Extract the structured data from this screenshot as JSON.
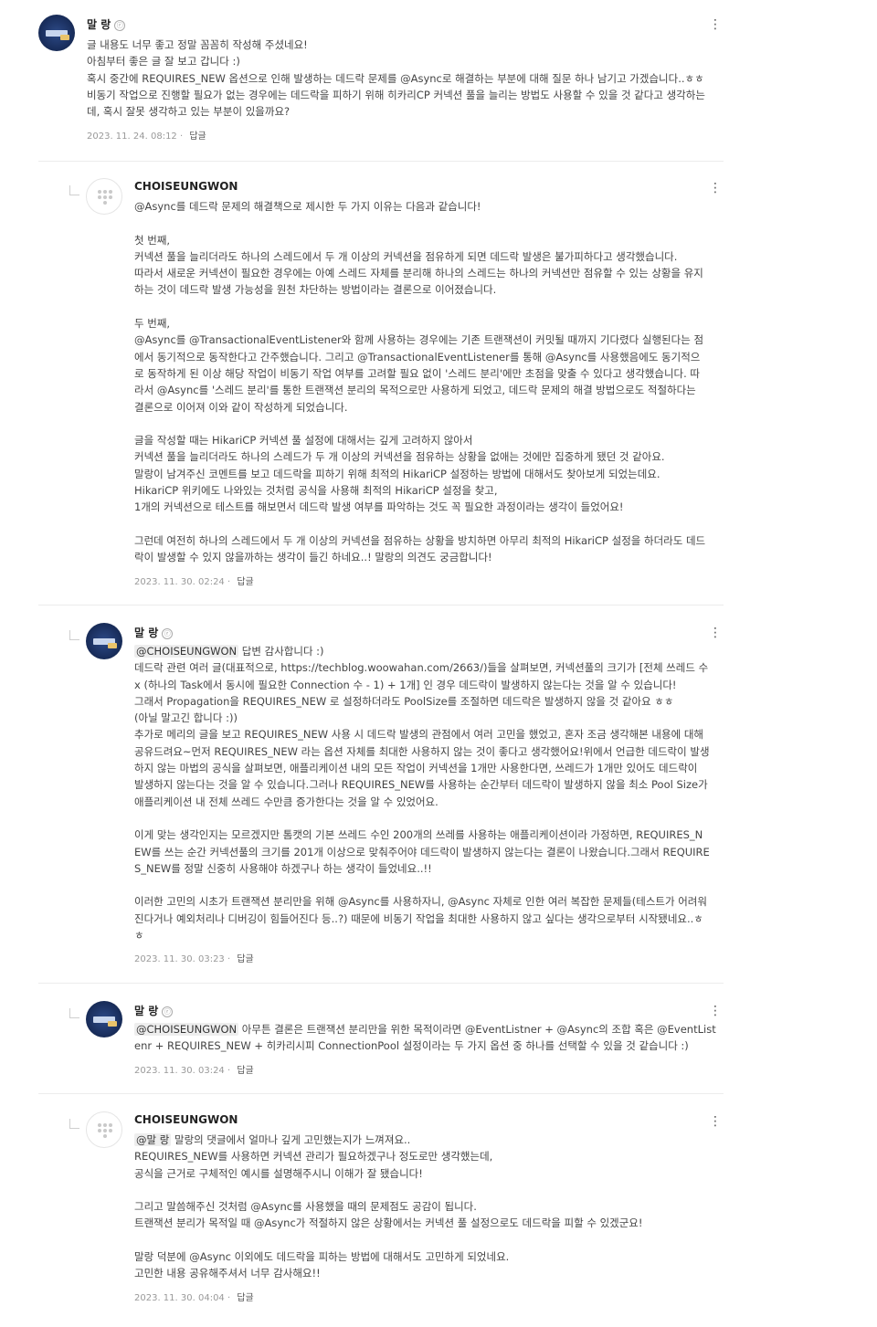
{
  "comments": [
    {
      "author": "말 랑",
      "badge": "ⓡ",
      "avatar": "photo",
      "lines": [
        "글 내용도 너무 좋고 정말 꼼꼼히 작성해 주셨네요!",
        "아침부터 좋은 글 잘 보고 갑니다 :)",
        "혹시 중간에 REQUIRES_NEW 옵션으로 인해 발생하는 데드락 문제를 @Async로 해결하는 부분에 대해 질문 하나 남기고 가겠습니다..ㅎㅎ",
        "비동기 작업으로 진행할 필요가 없는 경우에는 데드락을 피하기 위해 히카리CP 커넥션 풀을 늘리는 방법도 사용할 수 있을 것 같다고 생각하는",
        "데, 혹시 잘못 생각하고 있는 부분이 있을까요?"
      ],
      "date": "2023. 11. 24. 08:12",
      "reply_label": "답글"
    },
    {
      "author": "CHOISEUNGWON",
      "avatar": "default",
      "lines": [
        "@Async를 데드락 문제의 해결책으로 제시한 두 가지 이유는 다음과 같습니다!",
        "",
        "첫 번째,",
        "커넥션 풀을 늘리더라도 하나의 스레드에서 두 개 이상의 커넥션을 점유하게 되면 데드락 발생은 불가피하다고 생각했습니다.",
        "따라서 새로운 커넥션이 필요한 경우에는 아예 스레드 자체를 분리해 하나의 스레드는 하나의 커넥션만 점유할 수 있는 상황을 유지",
        "하는 것이 데드락 발생 가능성을 원천 차단하는 방법이라는 결론으로 이어졌습니다.",
        "",
        "두 번째,",
        "@Async를 @TransactionalEventListener와 함께 사용하는 경우에는 기존 트랜잭션이 커밋될 때까지 기다렸다 실행된다는 점",
        "에서 동기적으로 동작한다고 간주했습니다. 그리고 @TransactionalEventListener를 통해 @Async를 사용했음에도 동기적으",
        "로 동작하게 된 이상 해당 작업이 비동기 작업 여부를 고려할 필요 없이 '스레드 분리'에만 초점을 맞출 수 있다고 생각했습니다. 따",
        "라서 @Async를 '스레드 분리'를 통한 트랜잭션 분리의 목적으로만 사용하게 되었고, 데드락 문제의 해결 방법으로도 적절하다는",
        "결론으로 이어져 이와 같이 작성하게 되었습니다.",
        "",
        "글을 작성할 때는 HikariCP 커넥션 풀 설정에 대해서는 깊게 고려하지 않아서",
        "커넥션 풀을 늘리더라도 하나의 스레드가 두 개 이상의 커넥션을 점유하는 상황을 없애는 것에만 집중하게 됐던 것 같아요.",
        "말랑이 남겨주신 코멘트를 보고 데드락을 피하기 위해 최적의 HikariCP 설정하는 방법에 대해서도 찾아보게 되었는데요.",
        "HikariCP 위키에도 나와있는 것처럼 공식을 사용해 최적의 HikariCP 설정을 찾고,",
        "1개의 커넥션으로 테스트를 해보면서 데드락 발생 여부를 파악하는 것도 꼭 필요한 과정이라는 생각이 들었어요!",
        "",
        "그런데 여전히 하나의 스레드에서 두 개 이상의 커넥션을 점유하는 상황을 방치하면 아무리 최적의 HikariCP 설정을 하더라도 데드",
        "락이 발생할 수 있지 않을까하는 생각이 들긴 하네요..! 말랑의 의견도 궁금합니다!"
      ],
      "date": "2023. 11. 30. 02:24",
      "reply_label": "답글"
    },
    {
      "author": "말 랑",
      "badge": "ⓡ",
      "avatar": "photo",
      "mention": "@CHOISEUNGWON",
      "lines": [
        " 답변 감사합니다 :)",
        "데드락 관련 여러 글(대표적으로, https://techblog.woowahan.com/2663/)들을 살펴보면, 커넥션풀의 크기가 [전체 쓰레드 수",
        "x (하나의 Task에서 동시에 필요한 Connection 수 - 1) + 1개] 인 경우 데드락이 발생하지 않는다는 것을 알 수 있습니다!",
        "그래서 Propagation을 REQUIRES_NEW 로 설정하더라도 PoolSize를 조절하면 데드락은 발생하지 않을 것 같아요 ㅎㅎ",
        "(아닐 말고긴 합니다 :))",
        "추가로 메리의 글을 보고 REQUIRES_NEW 사용 시 데드락 발생의 관점에서 여러 고민을 했었고, 혼자 조금 생각해본 내용에 대해",
        "공유드려요~먼저 REQUIRES_NEW 라는 옵션 자체를 최대한 사용하지 않는 것이 좋다고 생각했어요!위에서 언급한 데드락이 발생",
        "하지 않는 마법의 공식을 살펴보면, 애플리케이션 내의 모든 작업이 커넥션을 1개만 사용한다면, 쓰레드가 1개만 있어도 데드락이",
        "발생하지 않는다는 것을 알 수 있습니다.그러나 REQUIRES_NEW를 사용하는 순간부터 데드락이 발생하지 않을 최소 Pool Size가",
        "애플리케이션 내 전체 쓰레드 수만큼 증가한다는 것을 알 수 있었어요.",
        "",
        "이게 맞는 생각인지는 모르겠지만 톰캣의 기본 쓰레드 수인 200개의 쓰레를 사용하는 애플리케이션이라 가정하면, REQUIRES_N",
        "EW를 쓰는 순간 커넥션풀의 크기를 201개 이상으로 맞춰주어야 데드락이 발생하지 않는다는 결론이 나왔습니다.그래서 REQUIRE",
        "S_NEW를 정말 신중히 사용해야 하겠구나 하는 생각이 들었네요..!!",
        "",
        "이러한 고민의 시초가 트랜잭션 분리만을 위해 @Async를 사용하자니, @Async 자체로 인한 여러 복잡한 문제들(테스트가 어려워",
        "진다거나 예외처리나 디버깅이 힘들어진다 등..?) 때문에 비동기 작업을 최대한 사용하지 않고 싶다는 생각으로부터 시작됐네요..ㅎ",
        "ㅎ"
      ],
      "date": "2023. 11. 30. 03:23",
      "reply_label": "답글"
    },
    {
      "author": "말 랑",
      "badge": "ⓡ",
      "avatar": "photo",
      "mention": "@CHOISEUNGWON",
      "lines": [
        " 아무튼 결론은 트랜잭션 분리만을 위한 목적이라면 @EventListner + @Async의 조합 혹은 @EventList",
        "enr + REQUIRES_NEW + 히카리시피 ConnectionPool 설정이라는 두 가지 옵션 중 하나를 선택할 수 있을 것 같습니다 :)"
      ],
      "date": "2023. 11. 30. 03:24",
      "reply_label": "답글"
    },
    {
      "author": "CHOISEUNGWON",
      "avatar": "default",
      "mention": "@말 랑",
      "lines": [
        " 말랑의 댓글에서 얼마나 깊게 고민했는지가 느껴져요..",
        "REQUIRES_NEW를 사용하면 커넥션 관리가 필요하겠구나 정도로만 생각했는데,",
        "공식을 근거로 구체적인 예시를 설명해주시니 이해가 잘 됐습니다!",
        "",
        "그리고 말씀해주신 것처럼 @Async를 사용했을 때의 문제점도 공감이 됩니다.",
        "트랜잭션 분리가 목적일 때 @Async가 적절하지 않은 상황에서는 커넥션 풀 설정으로도 데드락을 피할 수 있겠군요!",
        "",
        "말랑 덕분에 @Async 이외에도 데드락을 피하는 방법에 대해서도 고민하게 되었네요.",
        "고민한 내용 공유해주셔서 너무 감사해요!!"
      ],
      "date": "2023. 11. 30. 04:04",
      "reply_label": "답글"
    }
  ]
}
